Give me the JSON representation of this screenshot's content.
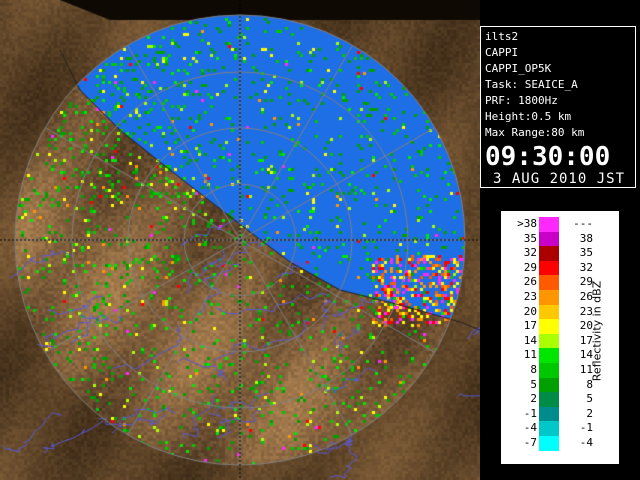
{
  "window": {
    "title": ""
  },
  "radar_view": {
    "background": "#7a6040",
    "echo_bg": "#1e6ee6",
    "ring_color": "#808080",
    "river_color": "#5a5ad2",
    "icon": "radar-scan-map"
  },
  "info": {
    "station": "ilts2",
    "product": "CAPPI",
    "product_id": "CAPPI_OP5K",
    "task": "Task: SEAICE_A",
    "prf": "PRF: 1800Hz",
    "height": "Height:0.5 km",
    "max_range": "Max Range:80 km",
    "time": "09:30:00",
    "date": "3 AUG 2010 JST"
  },
  "legend": {
    "axis_label": "Reflectivity in dBZ",
    "rows": [
      {
        "left": ">38",
        "right": "---",
        "color": "#ff28ff"
      },
      {
        "left": "35",
        "right": "38",
        "color": "#c800c8"
      },
      {
        "left": "32",
        "right": "35",
        "color": "#aa0000"
      },
      {
        "left": "29",
        "right": "32",
        "color": "#ff0000"
      },
      {
        "left": "26",
        "right": "29",
        "color": "#ff5a00"
      },
      {
        "left": "23",
        "right": "26",
        "color": "#ff9600"
      },
      {
        "left": "20",
        "right": "23",
        "color": "#ffc800"
      },
      {
        "left": "17",
        "right": "20",
        "color": "#ffff00"
      },
      {
        "left": "14",
        "right": "17",
        "color": "#aaff00"
      },
      {
        "left": "11",
        "right": "14",
        "color": "#00e600"
      },
      {
        "left": "8",
        "right": "11",
        "color": "#00c800"
      },
      {
        "left": "5",
        "right": "8",
        "color": "#00a000"
      },
      {
        "left": "2",
        "right": "5",
        "color": "#008c46"
      },
      {
        "left": "-1",
        "right": "2",
        "color": "#008c8c"
      },
      {
        "left": "-4",
        "right": "-1",
        "color": "#00c8c8"
      },
      {
        "left": "-7",
        "right": "-4",
        "color": "#00ffff"
      }
    ]
  }
}
